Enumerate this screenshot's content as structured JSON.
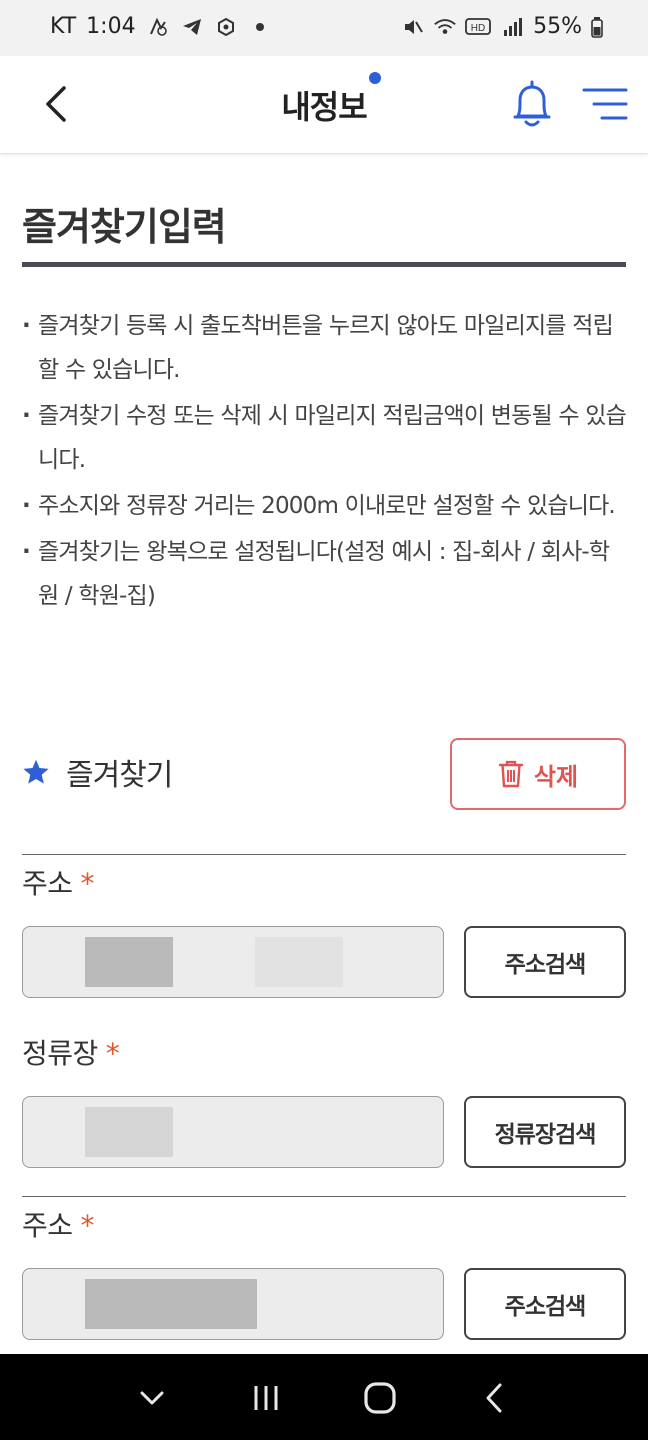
{
  "status_bar": {
    "carrier": "KT",
    "time": "1:04",
    "battery": "55%",
    "hd": "HD"
  },
  "header": {
    "title": "내정보"
  },
  "page": {
    "title": "즐겨찾기입력",
    "notices": [
      "즐겨찾기 등록 시 출도착버튼을 누르지 않아도 마일리지를 적립할 수 있습니다.",
      "즐겨찾기 수정 또는 삭제 시 마일리지 적립금액이 변동될 수 있습니다.",
      "주소지와 정류장 거리는 2000m 이내로만 설정할 수 있습니다.",
      "즐겨찾기는 왕복으로 설정됩니다(설정 예시 : 집-회사 / 회사-학원 / 학원-집)"
    ]
  },
  "favorite": {
    "title": "즐겨찾기",
    "delete_label": "삭제",
    "fields": [
      {
        "label": "주소",
        "required_mark": "*",
        "button": "주소검색"
      },
      {
        "label": "정류장",
        "required_mark": "*",
        "button": "정류장검색"
      },
      {
        "label": "주소",
        "required_mark": "*",
        "button": "주소검색"
      }
    ]
  },
  "colors": {
    "accent_blue": "#2f5fd8",
    "delete_red": "#e05353",
    "required_orange": "#e0572f"
  },
  "icons": [
    "back-chevron-icon",
    "bell-icon",
    "menu-icon",
    "star-icon",
    "trash-icon",
    "nav-down-icon",
    "nav-recents-icon",
    "nav-home-icon",
    "nav-back-icon"
  ]
}
